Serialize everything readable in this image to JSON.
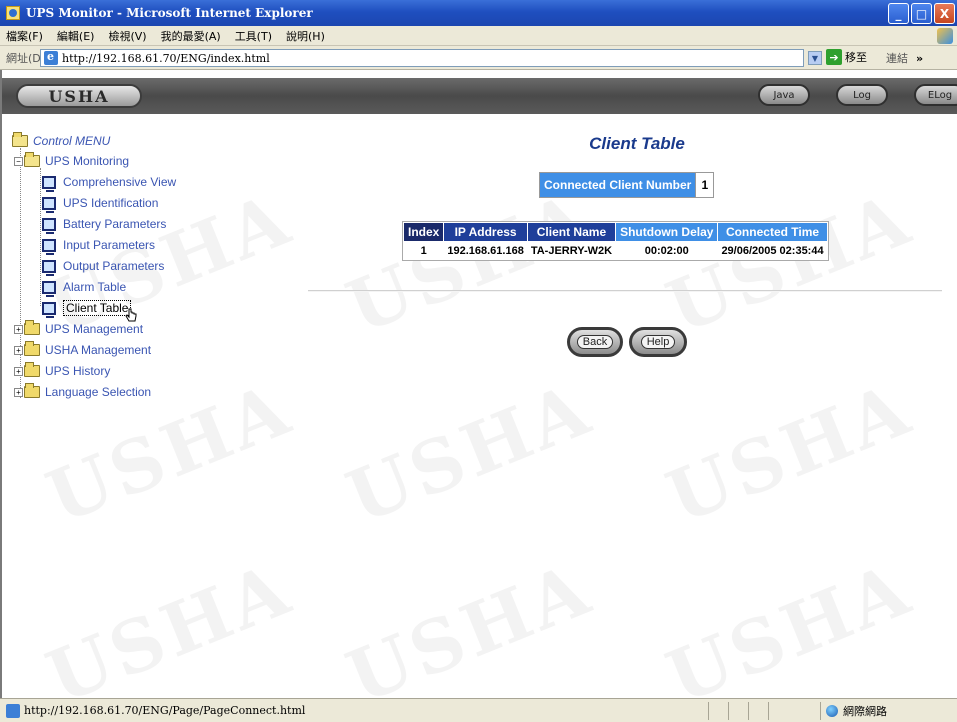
{
  "window": {
    "title": "UPS Monitor - Microsoft Internet Explorer",
    "min": "_",
    "max": "□",
    "close": "X"
  },
  "menu": [
    "檔案(F)",
    "編輯(E)",
    "檢視(V)",
    "我的最愛(A)",
    "工具(T)",
    "說明(H)"
  ],
  "address": {
    "label": "網址(D)",
    "url": "http://192.168.61.70/ENG/index.html",
    "go": "移至",
    "links": "連結"
  },
  "header": {
    "logo": "USHA",
    "buttons": [
      "Java",
      "Log",
      "ELog"
    ]
  },
  "watermark": "USHA",
  "tree": {
    "root": "Control MENU",
    "monitoring": "UPS Monitoring",
    "items": [
      "Comprehensive View",
      "UPS Identification",
      "Battery Parameters",
      "Input Parameters",
      "Output Parameters",
      "Alarm Table",
      "Client Table"
    ],
    "groups": [
      "UPS Management",
      "USHA Management",
      "UPS History",
      "Language Selection"
    ]
  },
  "main": {
    "title": "Client Table",
    "count_label": "Connected Client Number",
    "count_value": "1",
    "table": {
      "headers": [
        "Index",
        "IP Address",
        "Client Name",
        "Shutdown Delay",
        "Connected Time"
      ],
      "rows": [
        [
          "1",
          "192.168.61.168",
          "TA-JERRY-W2K",
          "00:02:00",
          "29/06/2005 02:35:44"
        ]
      ]
    },
    "back": "Back",
    "help": "Help"
  },
  "status": {
    "url": "http://192.168.61.70/ENG/Page/PageConnect.html",
    "zone": "網際網路"
  }
}
